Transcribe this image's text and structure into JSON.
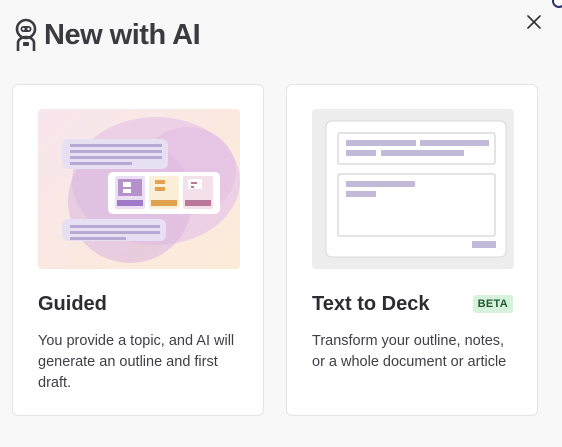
{
  "dialog": {
    "title": "New with AI",
    "close_icon": "close-icon",
    "header_icon": "robot-icon"
  },
  "cards": [
    {
      "title": "Guided",
      "description": "You provide a topic, and AI will generate an outline and first draft.",
      "illustration": "guided-illustration"
    },
    {
      "title": "Text to Deck",
      "badge": "BETA",
      "description": "Transform your outline, notes, or a whole document or article",
      "illustration": "text-to-deck-illustration"
    }
  ],
  "colors": {
    "beta_bg": "#d7f2da",
    "beta_text": "#1f5a34",
    "placeholder_lilac": "#c3b9d9",
    "accent_purple": "#a07ac8",
    "accent_orange": "#e0a24e",
    "accent_mauve": "#b9789a"
  }
}
